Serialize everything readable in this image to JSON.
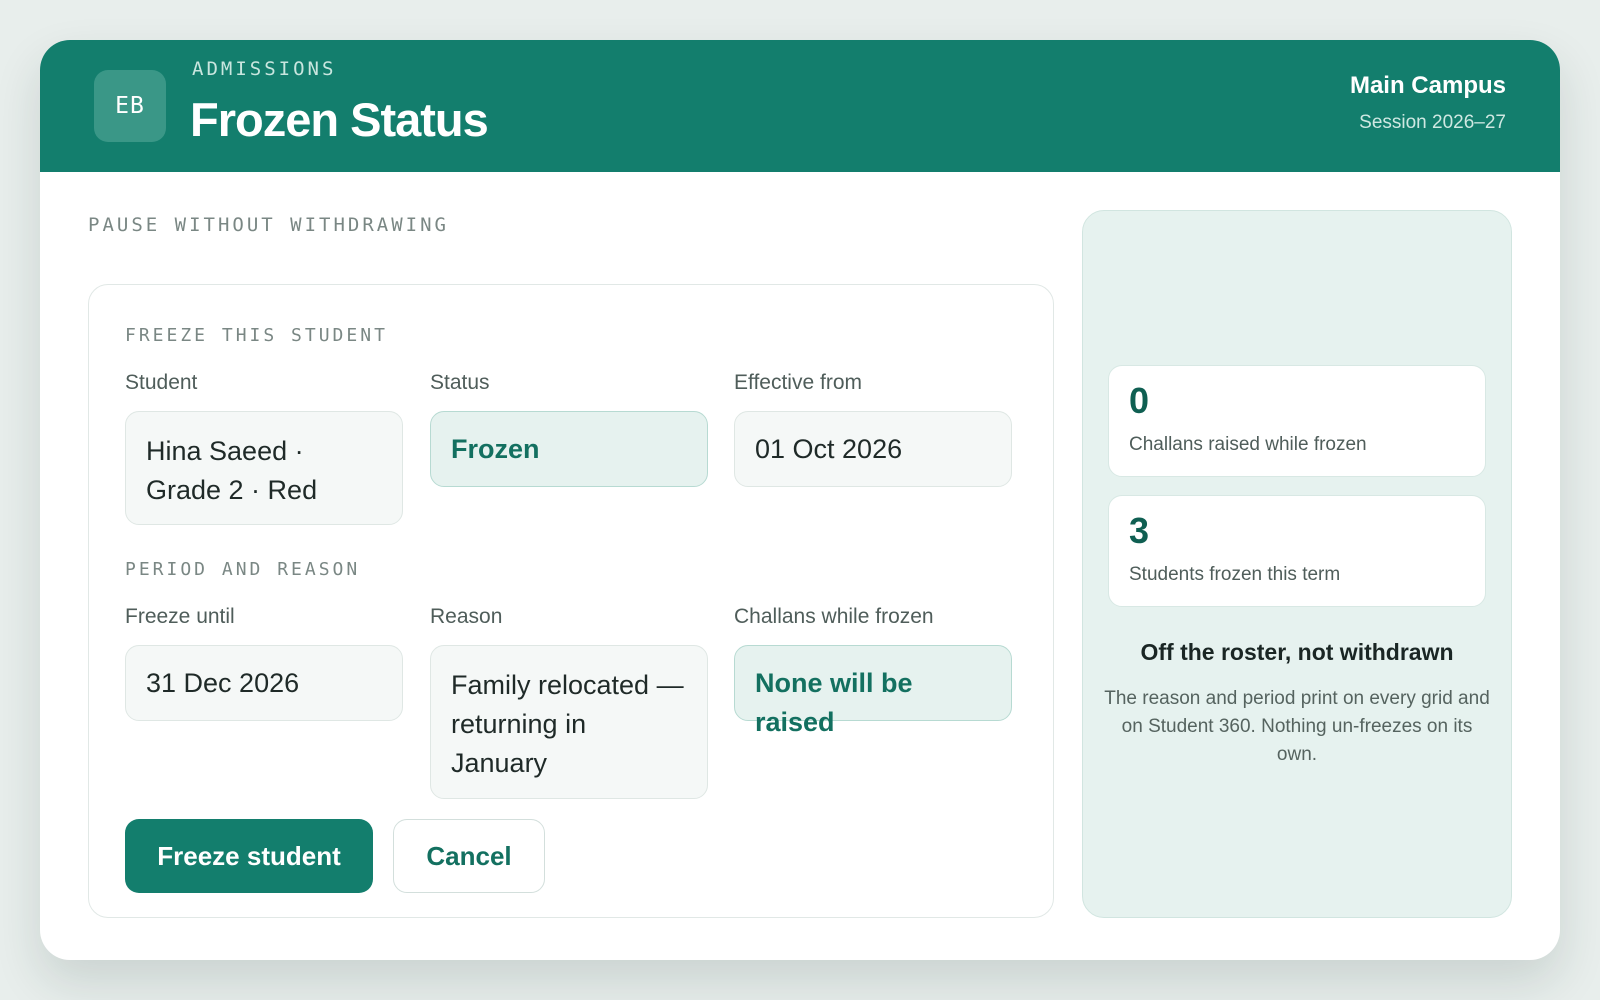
{
  "header": {
    "avatar_initials": "EB",
    "eyebrow": "ADMISSIONS",
    "title": "Frozen Status",
    "campus": "Main Campus",
    "session": "Session 2026–27"
  },
  "main": {
    "section_eyebrow": "PAUSE WITHOUT WITHDRAWING",
    "form": {
      "group1_eyebrow": "FREEZE THIS STUDENT",
      "group2_eyebrow": "PERIOD AND REASON",
      "fields": {
        "student": {
          "label": "Student",
          "value": "Hina Saeed · Grade 2 · Red"
        },
        "status": {
          "label": "Status",
          "value": "Frozen"
        },
        "effective_from": {
          "label": "Effective from",
          "value": "01 Oct 2026"
        },
        "freeze_until": {
          "label": "Freeze until",
          "value": "31 Dec 2026"
        },
        "reason": {
          "label": "Reason",
          "value": "Family relocated — returning in January"
        },
        "challans": {
          "label": "Challans while frozen",
          "value": "None will be raised"
        }
      },
      "actions": {
        "primary": "Freeze student",
        "secondary": "Cancel"
      }
    }
  },
  "side": {
    "stats": [
      {
        "value": "0",
        "label": "Challans raised while frozen"
      },
      {
        "value": "3",
        "label": "Students frozen this term"
      }
    ],
    "title": "Off the roster, not withdrawn",
    "body": "The reason and period print on every grid and on Student 360. Nothing un-freezes on its own."
  },
  "colors": {
    "brand": "#137e6d",
    "tint": "#e6f2ef"
  }
}
